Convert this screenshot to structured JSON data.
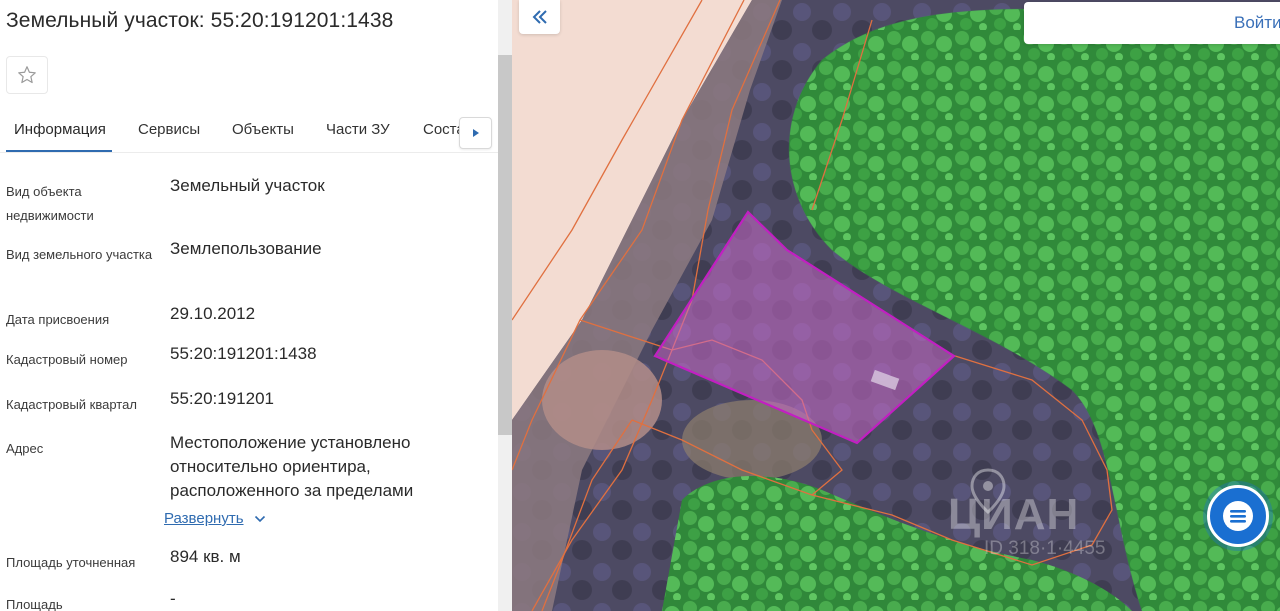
{
  "panel": {
    "title": "Земельный участок: 55:20:191201:1438",
    "tabs": [
      {
        "label": "Информация",
        "active": true
      },
      {
        "label": "Сервисы",
        "active": false
      },
      {
        "label": "Объекты",
        "active": false
      },
      {
        "label": "Части ЗУ",
        "active": false
      },
      {
        "label": "Соста",
        "active": false
      }
    ],
    "fields": [
      {
        "label": "Вид объекта недвижимости",
        "value": "Земельный участок"
      },
      {
        "label": "Вид земельного участка",
        "value": "Землепользование"
      },
      {
        "label": "Дата присвоения",
        "value": "29.10.2012"
      },
      {
        "label": "Кадастровый номер",
        "value": "55:20:191201:1438"
      },
      {
        "label": "Кадастровый квартал",
        "value": "55:20:191201"
      },
      {
        "label": "Адрес",
        "value": "Местоположение установлено относительно ориентира, расположенного за пределами"
      },
      {
        "label": "Площадь уточненная",
        "value": "894 кв. м"
      },
      {
        "label": "Площадь",
        "value": "-"
      }
    ],
    "expand_label": "Развернуть"
  },
  "map": {
    "login_label": "Войти",
    "watermark": "ЦИАН",
    "watermark_id": "ID 318·1·4455",
    "colors": {
      "parcel_outline": "#c21fc2",
      "parcel_fill": "#c86ac8",
      "boundary": "#e07040",
      "forest": "#2f8f3a",
      "chat": "#1a6fd1"
    }
  },
  "icons": {
    "favorite": "star-outline-icon",
    "tab_next": "triangle-right-icon",
    "collapse": "double-chevron-left-icon",
    "chat": "chat-bubble-icon",
    "expand": "chevron-down-icon"
  }
}
